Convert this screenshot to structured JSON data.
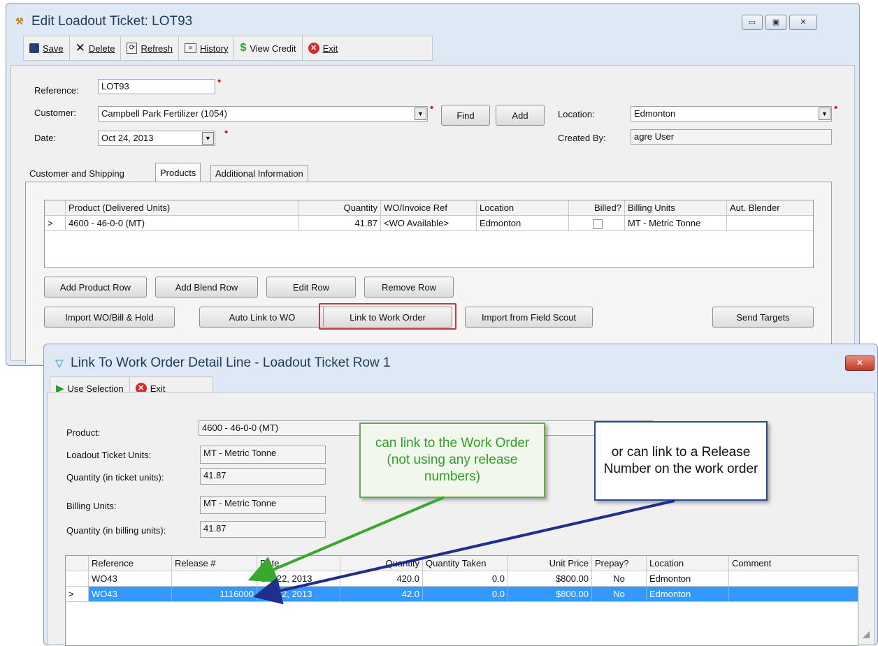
{
  "main_window": {
    "title": "Edit Loadout Ticket: LOT93",
    "toolbar": {
      "save": "Save",
      "delete": "Delete",
      "refresh": "Refresh",
      "history": "History",
      "view_credit": "View Credit",
      "exit": "Exit"
    },
    "form": {
      "reference_label": "Reference:",
      "reference_value": "LOT93",
      "customer_label": "Customer:",
      "customer_value": "Campbell Park Fertilizer (1054)",
      "find_label": "Find",
      "add_label": "Add",
      "location_label": "Location:",
      "location_value": "Edmonton",
      "date_label": "Date:",
      "date_value": "Oct 24, 2013",
      "created_by_label": "Created By:",
      "created_by_value": "agre User"
    },
    "tabs": [
      "Customer and Shipping",
      "Products",
      "Additional Information"
    ],
    "products_grid": {
      "columns": [
        "Product (Delivered Units)",
        "Quantity",
        "WO/Invoice Ref",
        "Location",
        "Billed?",
        "Billing Units",
        "Aut. Blender"
      ],
      "rows": [
        {
          "indicator": ">",
          "product": "4600 - 46-0-0 (MT)",
          "quantity": "41.87",
          "wo_ref": "<WO Available>",
          "location": "Edmonton",
          "billed": false,
          "billing_units": "MT - Metric Tonne",
          "blender": ""
        }
      ]
    },
    "buttons": {
      "add_product_row": "Add Product Row",
      "add_blend_row": "Add Blend Row",
      "edit_row": "Edit Row",
      "remove_row": "Remove Row",
      "import_wo": "Import WO/Bill & Hold",
      "auto_link": "Auto Link to WO",
      "link_wo": "Link to Work Order",
      "import_field_scout": "Import from Field Scout",
      "send_targets": "Send Targets"
    }
  },
  "link_window": {
    "title": "Link To Work Order Detail Line - Loadout Ticket Row 1",
    "toolbar": {
      "use_selection": "Use Selection",
      "exit": "Exit"
    },
    "fields": {
      "product_label": "Product:",
      "product_value": "4600 - 46-0-0 (MT)",
      "lt_units_label": "Loadout Ticket Units:",
      "lt_units_value": "MT - Metric Tonne",
      "qty_ticket_label": "Quantity (in ticket units):",
      "qty_ticket_value": "41.87",
      "billing_units_label": "Billing Units:",
      "billing_units_value": "MT - Metric Tonne",
      "qty_billing_label": "Quantity (in billing units):",
      "qty_billing_value": "41.87"
    },
    "grid": {
      "columns": [
        "Reference",
        "Release #",
        "Date",
        "Quantity",
        "Quantity Taken",
        "Unit Price",
        "Prepay?",
        "Location",
        "Comment"
      ],
      "rows": [
        {
          "indicator": "",
          "reference": "WO43",
          "release": "",
          "date": "Oct 22, 2013",
          "quantity": "420.0",
          "taken": "0.0",
          "price": "$800.00",
          "prepay": "No",
          "location": "Edmonton",
          "comment": ""
        },
        {
          "indicator": ">",
          "reference": "WO43",
          "release": "1116000",
          "date": "Oct 22, 2013",
          "quantity": "42.0",
          "taken": "0.0",
          "price": "$800.00",
          "prepay": "No",
          "location": "Edmonton",
          "comment": ""
        }
      ]
    }
  },
  "callouts": {
    "green": "can link to the Work Order (not using any release numbers)",
    "blue": "or can link to a Release Number on the work order"
  },
  "colors": {
    "selection": "#3399ff",
    "highlight_border": "#c0393b",
    "green_arrow": "#3aa82e",
    "blue_arrow": "#1f2f8c",
    "required": "#e02020"
  }
}
